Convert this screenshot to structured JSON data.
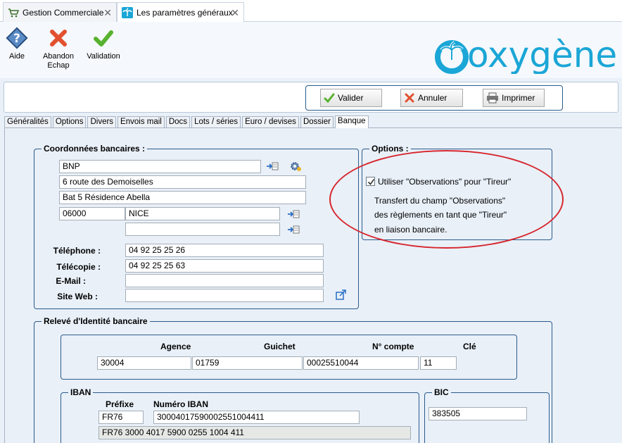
{
  "doc_tabs": [
    {
      "label": "Gestion Commerciale"
    },
    {
      "label": "Les paramètres généraux"
    }
  ],
  "ribbon": {
    "aide": "Aide",
    "abandon_line1": "Abandon",
    "abandon_line2": "Echap",
    "validation": "Validation"
  },
  "logo_text": "oxygène",
  "actions": {
    "valider": "Valider",
    "annuler": "Annuler",
    "imprimer": "Imprimer"
  },
  "sub_tabs": [
    "Généralités",
    "Options",
    "Divers",
    "Envois mail",
    "Docs",
    "Lots / séries",
    "Euro / devises",
    "Dossier",
    "Banque"
  ],
  "coordonnees": {
    "title": "Coordonnées bancaires :",
    "nom": "BNP",
    "adresse1": "6 route des Demoiselles",
    "adresse2": "Bat 5 Résidence Abella",
    "code_postal": "06000",
    "ville": "NICE",
    "ville2": "",
    "telephone_label": "Téléphone :",
    "telephone": "04 92 25 25 26",
    "telecopie_label": "Télécopie :",
    "telecopie": "04 92 25 25 63",
    "email_label": "E-Mail :",
    "email": "",
    "site_label": "Site Web :",
    "site": ""
  },
  "options": {
    "title": "Options :",
    "checkbox_label": "Utiliser \"Observations\" pour \"Tireur\"",
    "checked": true,
    "desc1": "Transfert du champ \"Observations\"",
    "desc2": "des règlements en tant que \"Tireur\"",
    "desc3": "en liaison bancaire."
  },
  "rib": {
    "title": "Relevé d'Identité bancaire",
    "agence_label": "Agence",
    "guichet_label": "Guichet",
    "compte_label": "N° compte",
    "cle_label": "Clé",
    "agence": "30004",
    "guichet": "01759",
    "compte": "00025510044",
    "cle": "11"
  },
  "iban": {
    "title": "IBAN",
    "prefixe_label": "Préfixe",
    "numero_label": "Numéro IBAN",
    "prefixe": "FR76",
    "numero": "30004017590002551004411",
    "formatted": "FR76  3000  4017  5900  0255  1004  411"
  },
  "bic": {
    "title": "BIC",
    "value": "383505"
  },
  "colors": {
    "accent": "#2a5b8c",
    "highlight": "#d7262e",
    "logo": "#1aa6d6"
  }
}
